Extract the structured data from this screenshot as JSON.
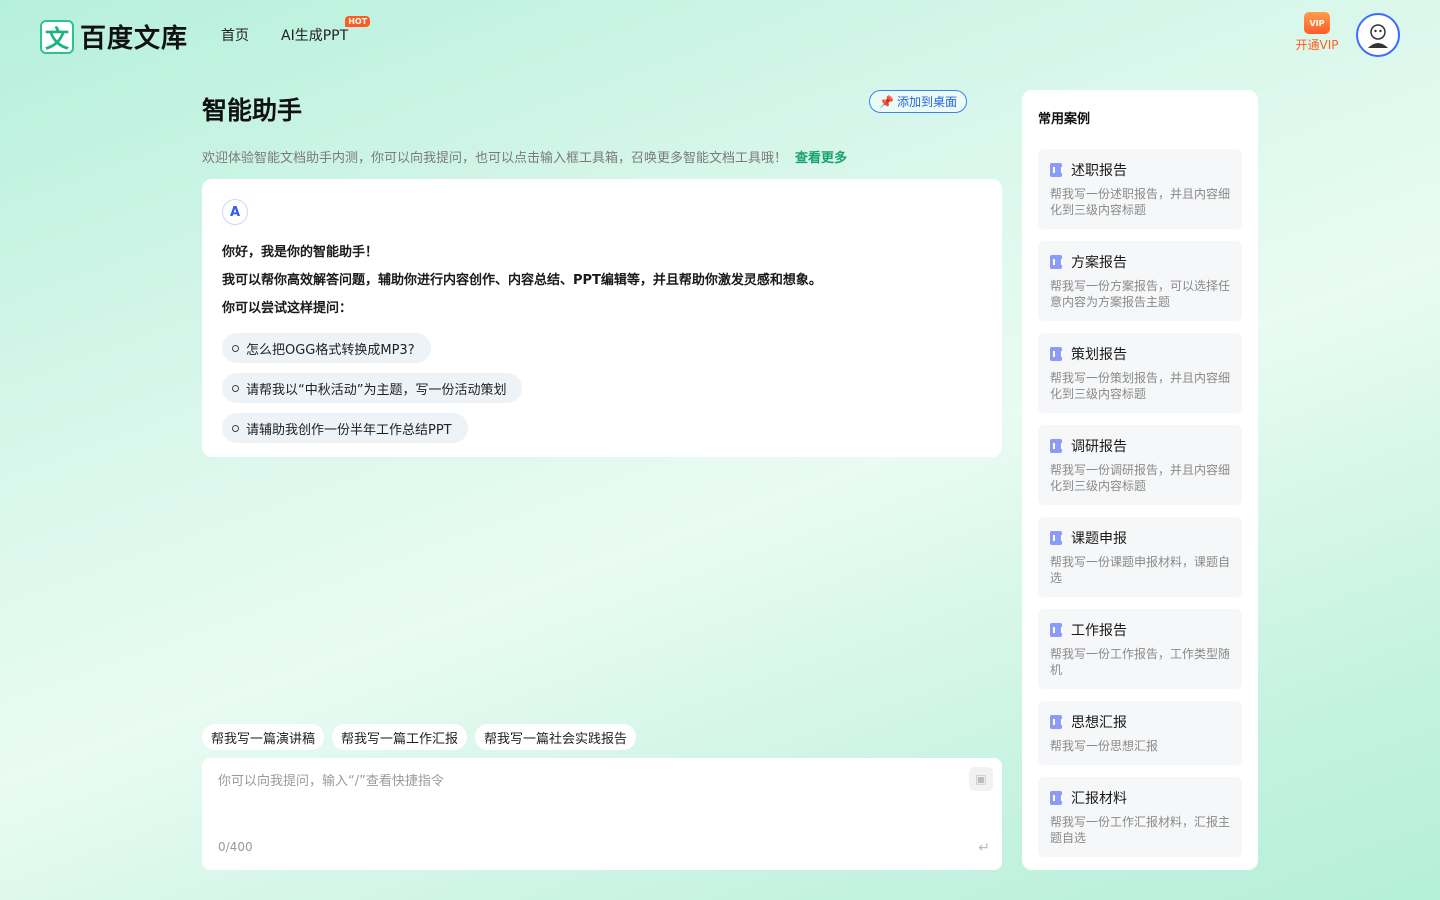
{
  "header": {
    "logo_mark": "文",
    "logo_text": "百度文库",
    "nav": [
      {
        "label": "首页"
      },
      {
        "label": "AI生成PPT",
        "badge": "HOT"
      }
    ],
    "vip_icon_text": "VIP",
    "vip_label": "开通VIP",
    "avatar_icon": "user-avatar-icon"
  },
  "main": {
    "title": "智能助手",
    "add_desktop_label": "添加到桌面",
    "intro": "欢迎体验智能文档助手内测，你可以向我提问，也可以点击输入框工具箱，召唤更多智能文档工具哦！",
    "intro_more": "查看更多",
    "chat": {
      "bot_icon_text": "A",
      "greeting_line1": "你好，我是你的智能助手！",
      "greeting_line2": "我可以帮你高效解答问题，辅助你进行内容创作、内容总结、PPT编辑等，并且帮助你激发灵感和想象。",
      "greeting_line3": "你可以尝试这样提问：",
      "suggestions": [
        "怎么把OGG格式转换成MP3?",
        "请帮我以“中秋活动”为主题，写一份活动策划",
        "请辅助我创作一份半年工作总结PPT"
      ]
    },
    "quick_prompts": [
      "帮我写一篇演讲稿",
      "帮我写一篇工作汇报",
      "帮我写一篇社会实践报告"
    ],
    "input": {
      "placeholder": "你可以向我提问，输入“/”查看快捷指令",
      "value": "",
      "counter": "0/400"
    }
  },
  "sidebar": {
    "title": "常用案例",
    "cases": [
      {
        "title": "述职报告",
        "desc": "帮我写一份述职报告，并且内容细化到三级内容标题"
      },
      {
        "title": "方案报告",
        "desc": "帮我写一份方案报告，可以选择任意内容为方案报告主题"
      },
      {
        "title": "策划报告",
        "desc": "帮我写一份策划报告，并且内容细化到三级内容标题"
      },
      {
        "title": "调研报告",
        "desc": "帮我写一份调研报告，并且内容细化到三级内容标题"
      },
      {
        "title": "课题申报",
        "desc": "帮我写一份课题申报材料，课题自选"
      },
      {
        "title": "工作报告",
        "desc": "帮我写一份工作报告，工作类型随机"
      },
      {
        "title": "思想汇报",
        "desc": "帮我写一份思想汇报"
      },
      {
        "title": "汇报材料",
        "desc": "帮我写一份工作汇报材料，汇报主题自选"
      }
    ]
  },
  "colors": {
    "accent": "#18a36f",
    "vip": "#ff5f1f",
    "link": "#2563eb"
  }
}
